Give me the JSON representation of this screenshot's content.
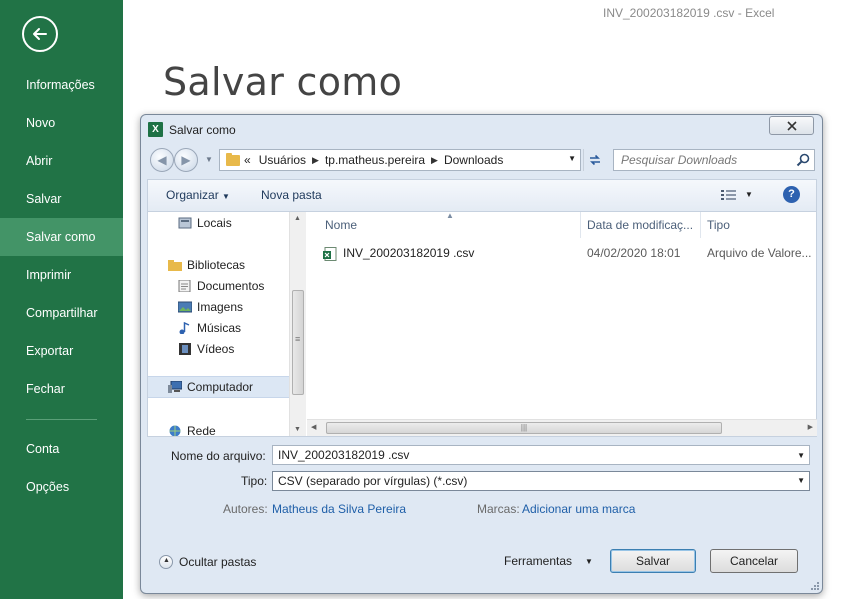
{
  "window": {
    "title": "INV_200203182019 .csv - Excel"
  },
  "backstage": {
    "page_title": "Salvar como",
    "nav": [
      {
        "label": "Informações"
      },
      {
        "label": "Novo"
      },
      {
        "label": "Abrir"
      },
      {
        "label": "Salvar"
      },
      {
        "label": "Salvar como",
        "active": true
      },
      {
        "label": "Imprimir"
      },
      {
        "label": "Compartilhar"
      },
      {
        "label": "Exportar"
      },
      {
        "label": "Fechar"
      },
      {
        "label": "Conta"
      },
      {
        "label": "Opções"
      }
    ]
  },
  "dialog": {
    "title": "Salvar como",
    "icon_letter": "X",
    "address": {
      "prefix": "«",
      "crumbs": [
        "Usuários",
        "tp.matheus.pereira",
        "Downloads"
      ]
    },
    "search": {
      "placeholder": "Pesquisar Downloads"
    },
    "toolbar": {
      "organize": "Organizar",
      "new_folder": "Nova pasta",
      "help": "?"
    },
    "nav_pane": [
      {
        "label": "Locais",
        "icon": "recent-places-icon"
      },
      {
        "label": "Bibliotecas",
        "icon": "libraries-icon"
      },
      {
        "label": "Documentos",
        "icon": "documents-icon"
      },
      {
        "label": "Imagens",
        "icon": "pictures-icon"
      },
      {
        "label": "Músicas",
        "icon": "music-icon"
      },
      {
        "label": "Vídeos",
        "icon": "videos-icon"
      },
      {
        "label": "Computador",
        "icon": "computer-icon"
      },
      {
        "label": "Rede",
        "icon": "network-icon"
      }
    ],
    "columns": {
      "name": "Nome",
      "date": "Data de modificaç...",
      "type": "Tipo"
    },
    "files": [
      {
        "name": "INV_200203182019 .csv",
        "date": "04/02/2020 18:01",
        "type": "Arquivo de Valore..."
      }
    ],
    "filename": {
      "label": "Nome do arquivo:",
      "value": "INV_200203182019 .csv"
    },
    "filetype": {
      "label": "Tipo:",
      "value": "CSV (separado por vírgulas) (*.csv)"
    },
    "authors": {
      "label": "Autores:",
      "value": "Matheus da Silva Pereira"
    },
    "tags": {
      "label": "Marcas:",
      "value": "Adicionar uma marca"
    },
    "hide_folders": "Ocultar pastas",
    "tools": "Ferramentas",
    "save": "Salvar",
    "cancel": "Cancelar"
  },
  "colors": {
    "excel_green": "#217346",
    "active_nav": "#439467",
    "link_blue": "#1f5fa8"
  }
}
